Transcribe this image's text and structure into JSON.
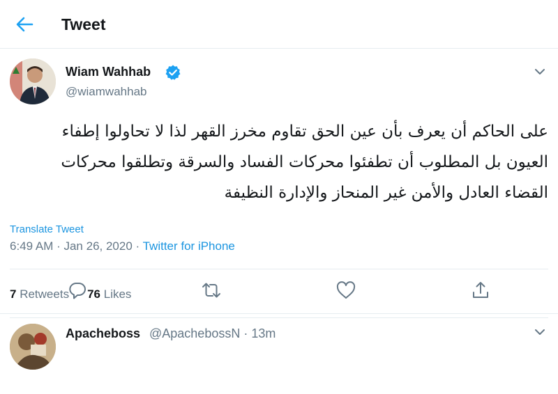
{
  "header": {
    "title": "Tweet"
  },
  "tweet": {
    "author_name": "Wiam Wahhab",
    "author_handle": "@wiamwahhab",
    "text_lines": [
      "على الحاكم أن يعرف بأن عين الحق تقاوم مخرز القهر لذا لا تحاولوا إطفاء",
      "العيون بل المطلوب أن تطفئوا محركات الفساد والسرقة وتطلقوا محركات",
      "القضاء العادل والأمن غير المنحاز والإدارة النظيفة"
    ],
    "translate_label": "Translate Tweet",
    "timestamp": "6:49 AM · Jan 26, 2020 · ",
    "source": "Twitter for iPhone",
    "retweets_count": "7",
    "retweets_label": "Retweets",
    "likes_count": "76",
    "likes_label": "Likes"
  },
  "actions": [
    {
      "icon": "reply-icon"
    },
    {
      "icon": "retweet-icon"
    },
    {
      "icon": "like-icon"
    },
    {
      "icon": "share-icon"
    }
  ],
  "reply": {
    "author_name": "Apacheboss",
    "author_meta": "@ApachebossN · 13m"
  },
  "colors": {
    "accent": "#1da1f2",
    "link": "#1b95e0",
    "secondary_text": "#657786",
    "border": "#e6ecf0"
  }
}
